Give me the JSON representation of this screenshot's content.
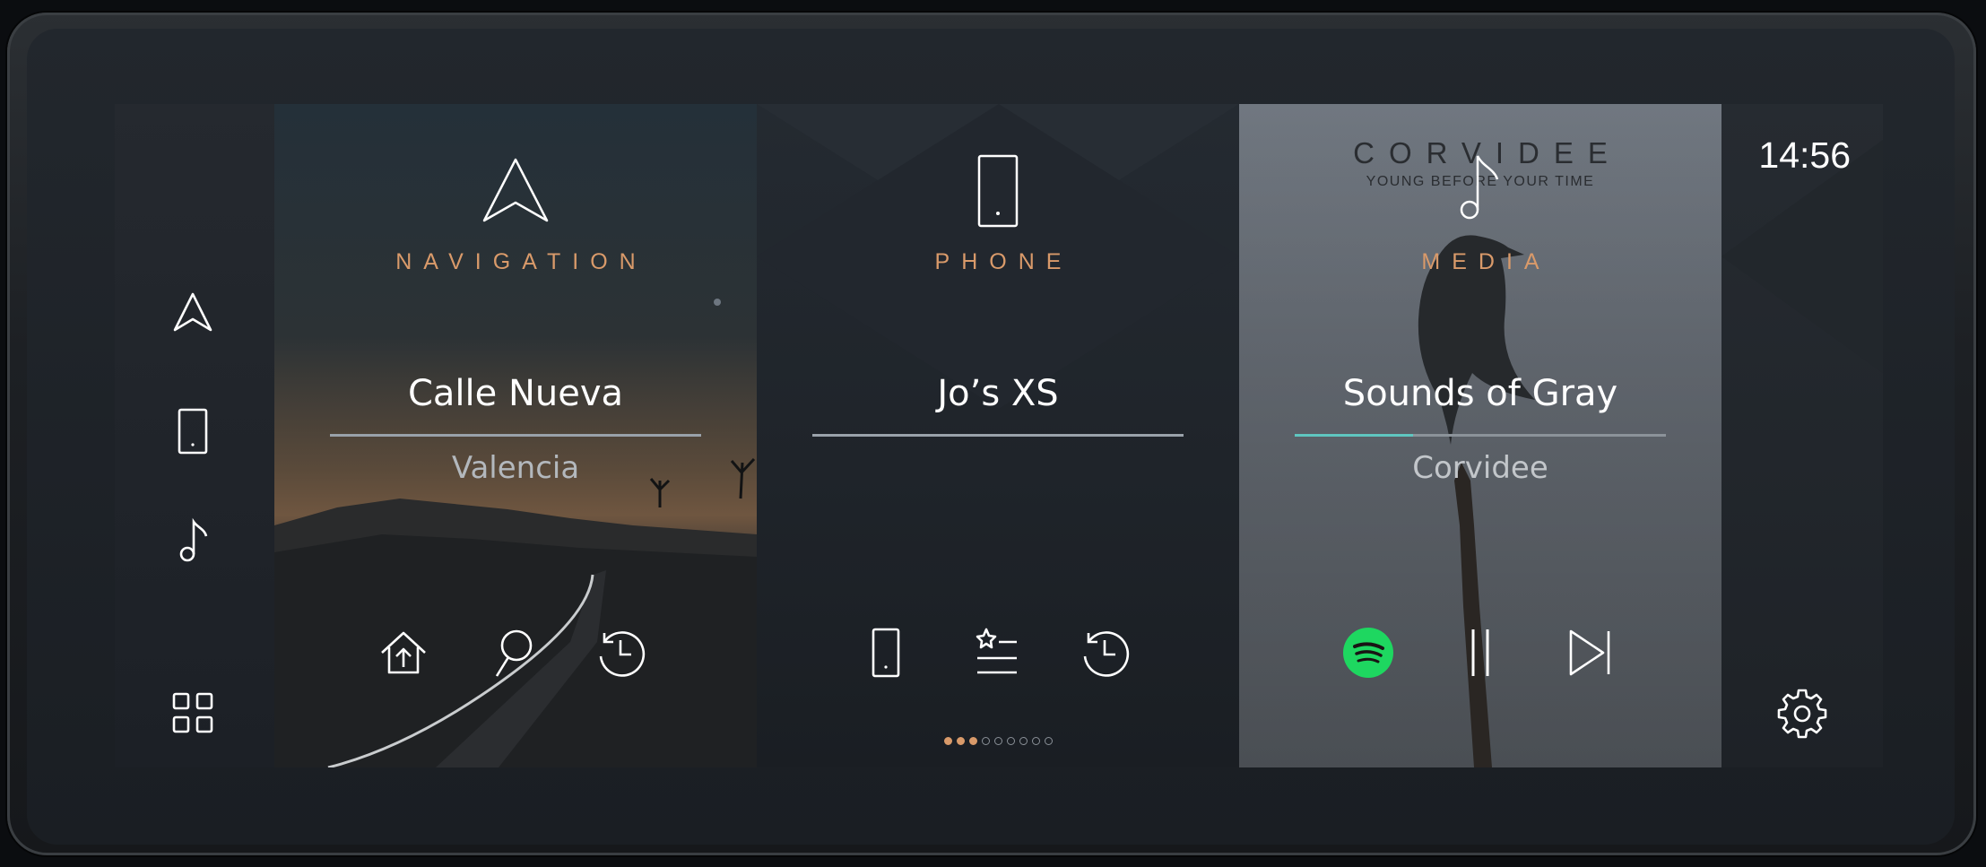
{
  "clock": "14:56",
  "rail": {
    "items": [
      {
        "icon": "navigation-arrow-icon"
      },
      {
        "icon": "phone-icon"
      },
      {
        "icon": "music-note-icon"
      },
      {
        "icon": "apps-grid-icon"
      }
    ]
  },
  "navigation": {
    "label": "NAVIGATION",
    "street": "Calle Nueva",
    "city": "Valencia",
    "actions": [
      "home-icon",
      "search-icon",
      "history-icon"
    ]
  },
  "phone": {
    "label": "PHONE",
    "device": "Jo’s XS",
    "actions": [
      "phone-icon",
      "favorites-icon",
      "history-icon"
    ],
    "page_indicator": {
      "total": 9,
      "active": [
        0,
        1,
        2
      ]
    }
  },
  "media": {
    "label": "MEDIA",
    "album_brand": "CORVIDEE",
    "album_tagline": "YOUNG BEFORE YOUR TIME",
    "track": "Sounds of Gray",
    "artist": "Corvidee",
    "progress": 0.32,
    "source_icon": "spotify-icon",
    "actions": [
      "spotify-icon",
      "pause-icon",
      "skip-next-icon"
    ]
  },
  "colors": {
    "accent_label": "#d99a6a",
    "progress": "#5fc6c0",
    "spotify": "#1ed760"
  },
  "settings_icon": "gear-icon"
}
